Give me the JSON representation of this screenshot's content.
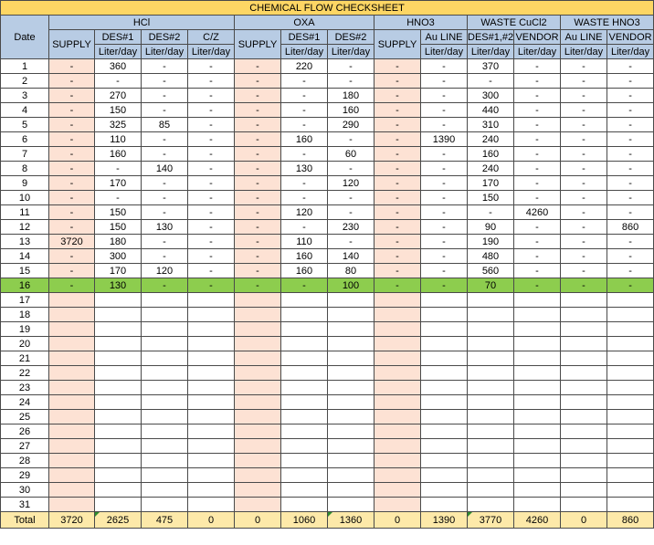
{
  "title": "CHEMICAL FLOW CHECKSHEET",
  "date_label": "Date",
  "unit": "Liter/day",
  "groups": [
    {
      "label": "HCl",
      "span": 4
    },
    {
      "label": "OXA",
      "span": 3
    },
    {
      "label": "HNO3",
      "span": 2
    },
    {
      "label": "WASTE CuCl2",
      "span": 2
    },
    {
      "label": "WASTE HNO3",
      "span": 2
    }
  ],
  "columns": [
    {
      "label": "SUPPLY",
      "supply": true
    },
    {
      "label": "DES#1"
    },
    {
      "label": "DES#2"
    },
    {
      "label": "C/Z"
    },
    {
      "label": "SUPPLY",
      "supply": true
    },
    {
      "label": "DES#1"
    },
    {
      "label": "DES#2"
    },
    {
      "label": "SUPPLY",
      "supply": true
    },
    {
      "label": "Au LINE"
    },
    {
      "label": "DES#1,#2"
    },
    {
      "label": "VENDOR"
    },
    {
      "label": "Au LINE"
    },
    {
      "label": "VENDOR"
    }
  ],
  "rows": [
    {
      "date": "1",
      "values": [
        "-",
        "360",
        "-",
        "-",
        "-",
        "220",
        "-",
        "-",
        "-",
        "370",
        "-",
        "-",
        "-"
      ]
    },
    {
      "date": "2",
      "values": [
        "-",
        "-",
        "-",
        "-",
        "-",
        "-",
        "-",
        "-",
        "-",
        "-",
        "-",
        "-",
        "-"
      ]
    },
    {
      "date": "3",
      "values": [
        "-",
        "270",
        "-",
        "-",
        "-",
        "-",
        "180",
        "-",
        "-",
        "300",
        "-",
        "-",
        "-"
      ]
    },
    {
      "date": "4",
      "values": [
        "-",
        "150",
        "-",
        "-",
        "-",
        "-",
        "160",
        "-",
        "-",
        "440",
        "-",
        "-",
        "-"
      ]
    },
    {
      "date": "5",
      "values": [
        "-",
        "325",
        "85",
        "-",
        "-",
        "-",
        "290",
        "-",
        "-",
        "310",
        "-",
        "-",
        "-"
      ]
    },
    {
      "date": "6",
      "values": [
        "-",
        "110",
        "-",
        "-",
        "-",
        "160",
        "-",
        "-",
        "1390",
        "240",
        "-",
        "-",
        "-"
      ]
    },
    {
      "date": "7",
      "values": [
        "-",
        "160",
        "-",
        "-",
        "-",
        "-",
        "60",
        "-",
        "-",
        "160",
        "-",
        "-",
        "-"
      ]
    },
    {
      "date": "8",
      "values": [
        "-",
        "-",
        "140",
        "-",
        "-",
        "130",
        "-",
        "-",
        "-",
        "240",
        "-",
        "-",
        "-"
      ]
    },
    {
      "date": "9",
      "values": [
        "-",
        "170",
        "-",
        "-",
        "-",
        "-",
        "120",
        "-",
        "-",
        "170",
        "-",
        "-",
        "-"
      ]
    },
    {
      "date": "10",
      "values": [
        "-",
        "-",
        "-",
        "-",
        "-",
        "-",
        "-",
        "-",
        "-",
        "150",
        "-",
        "-",
        "-"
      ]
    },
    {
      "date": "11",
      "values": [
        "-",
        "150",
        "-",
        "-",
        "-",
        "120",
        "-",
        "-",
        "-",
        "-",
        "4260",
        "-",
        "-"
      ]
    },
    {
      "date": "12",
      "values": [
        "-",
        "150",
        "130",
        "-",
        "-",
        "-",
        "230",
        "-",
        "-",
        "90",
        "-",
        "-",
        "860"
      ]
    },
    {
      "date": "13",
      "values": [
        "3720",
        "180",
        "-",
        "-",
        "-",
        "110",
        "-",
        "-",
        "-",
        "190",
        "-",
        "-",
        "-"
      ]
    },
    {
      "date": "14",
      "values": [
        "-",
        "300",
        "-",
        "-",
        "-",
        "160",
        "140",
        "-",
        "-",
        "480",
        "-",
        "-",
        "-"
      ]
    },
    {
      "date": "15",
      "values": [
        "-",
        "170",
        "120",
        "-",
        "-",
        "160",
        "80",
        "-",
        "-",
        "560",
        "-",
        "-",
        "-"
      ]
    },
    {
      "date": "16",
      "values": [
        "-",
        "130",
        "-",
        "-",
        "-",
        "-",
        "100",
        "-",
        "-",
        "70",
        "-",
        "-",
        "-"
      ],
      "highlight": true
    },
    {
      "date": "17",
      "values": [
        "",
        "",
        "",
        "",
        "",
        "",
        "",
        "",
        "",
        "",
        "",
        "",
        ""
      ]
    },
    {
      "date": "18",
      "values": [
        "",
        "",
        "",
        "",
        "",
        "",
        "",
        "",
        "",
        "",
        "",
        "",
        ""
      ]
    },
    {
      "date": "19",
      "values": [
        "",
        "",
        "",
        "",
        "",
        "",
        "",
        "",
        "",
        "",
        "",
        "",
        ""
      ]
    },
    {
      "date": "20",
      "values": [
        "",
        "",
        "",
        "",
        "",
        "",
        "",
        "",
        "",
        "",
        "",
        "",
        ""
      ]
    },
    {
      "date": "21",
      "values": [
        "",
        "",
        "",
        "",
        "",
        "",
        "",
        "",
        "",
        "",
        "",
        "",
        ""
      ]
    },
    {
      "date": "22",
      "values": [
        "",
        "",
        "",
        "",
        "",
        "",
        "",
        "",
        "",
        "",
        "",
        "",
        ""
      ]
    },
    {
      "date": "23",
      "values": [
        "",
        "",
        "",
        "",
        "",
        "",
        "",
        "",
        "",
        "",
        "",
        "",
        ""
      ]
    },
    {
      "date": "24",
      "values": [
        "",
        "",
        "",
        "",
        "",
        "",
        "",
        "",
        "",
        "",
        "",
        "",
        ""
      ]
    },
    {
      "date": "25",
      "values": [
        "",
        "",
        "",
        "",
        "",
        "",
        "",
        "",
        "",
        "",
        "",
        "",
        ""
      ]
    },
    {
      "date": "26",
      "values": [
        "",
        "",
        "",
        "",
        "",
        "",
        "",
        "",
        "",
        "",
        "",
        "",
        ""
      ]
    },
    {
      "date": "27",
      "values": [
        "",
        "",
        "",
        "",
        "",
        "",
        "",
        "",
        "",
        "",
        "",
        "",
        ""
      ]
    },
    {
      "date": "28",
      "values": [
        "",
        "",
        "",
        "",
        "",
        "",
        "",
        "",
        "",
        "",
        "",
        "",
        ""
      ]
    },
    {
      "date": "29",
      "values": [
        "",
        "",
        "",
        "",
        "",
        "",
        "",
        "",
        "",
        "",
        "",
        "",
        ""
      ]
    },
    {
      "date": "30",
      "values": [
        "",
        "",
        "",
        "",
        "",
        "",
        "",
        "",
        "",
        "",
        "",
        "",
        ""
      ]
    },
    {
      "date": "31",
      "values": [
        "",
        "",
        "",
        "",
        "",
        "",
        "",
        "",
        "",
        "",
        "",
        "",
        ""
      ]
    }
  ],
  "total_label": "Total",
  "totals": [
    "3720",
    "2625",
    "475",
    "0",
    "0",
    "1060",
    "1360",
    "0",
    "1390",
    "3770",
    "4260",
    "0",
    "860"
  ],
  "total_marked_columns": [
    1,
    6,
    9
  ],
  "colors": {
    "title_bg": "#fdd664",
    "header_bg": "#b8cce4",
    "supply_bg": "#fde2d4",
    "highlight_row_bg": "#8dcd4e",
    "total_bg": "#fde9a9"
  }
}
